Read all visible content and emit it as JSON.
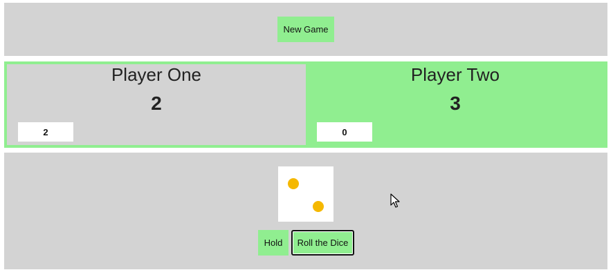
{
  "toolbar": {
    "new_game_label": "New Game"
  },
  "players": [
    {
      "name": "Player One",
      "total_score": "2",
      "current_score": "2",
      "active": false
    },
    {
      "name": "Player Two",
      "total_score": "3",
      "current_score": "0",
      "active": true
    }
  ],
  "dice": {
    "value": 2,
    "pip_color": "#f5b800",
    "icon": "die-face-two-icon"
  },
  "controls": {
    "hold_label": "Hold",
    "roll_label": "Roll the Dice"
  },
  "colors": {
    "active_panel": "#90ee90",
    "inactive_panel": "#d3d3d3",
    "button": "#90ee90"
  }
}
